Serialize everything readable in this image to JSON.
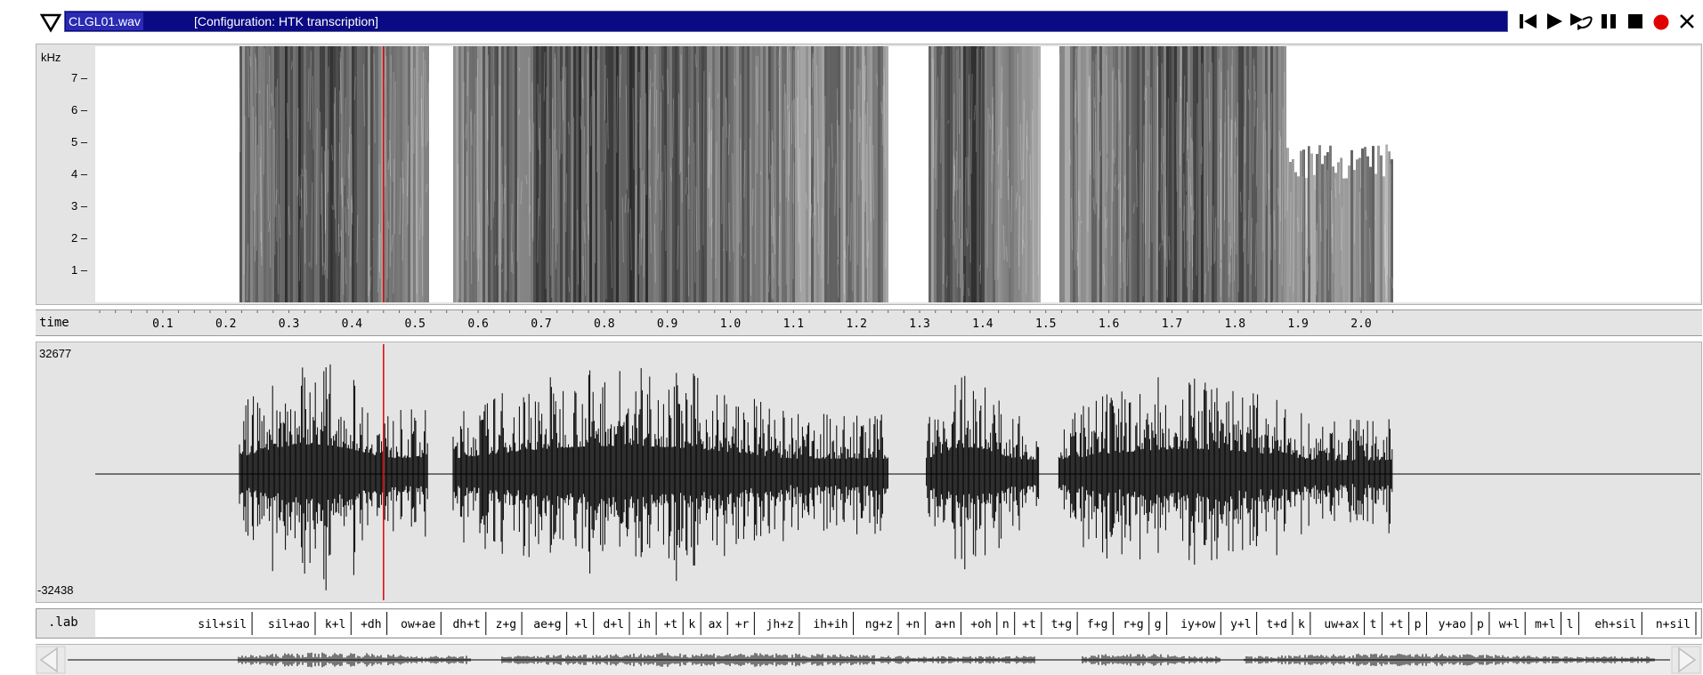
{
  "window": {
    "file_name": "CLGL01.wav",
    "configuration": "[Configuration: HTK transcription]",
    "accent_color": "#0a0a84",
    "record_color": "#e00000"
  },
  "toolbar": {
    "collapse_icon": "triangle-down-icon",
    "buttons": [
      {
        "name": "skip-to-start-button",
        "icon": "skip-start-icon"
      },
      {
        "name": "play-button",
        "icon": "play-icon"
      },
      {
        "name": "loop-play-button",
        "icon": "loop-play-icon"
      },
      {
        "name": "pause-button",
        "icon": "pause-icon"
      },
      {
        "name": "stop-button",
        "icon": "stop-icon"
      },
      {
        "name": "record-button",
        "icon": "record-dot-icon"
      },
      {
        "name": "close-button",
        "icon": "close-icon"
      }
    ]
  },
  "spectrogram": {
    "unit": "kHz",
    "ticks": [
      "7",
      "6",
      "5",
      "4",
      "3",
      "2",
      "1"
    ],
    "freq_max_khz": 8
  },
  "time_axis": {
    "label": "time",
    "ticks": [
      "0.1",
      "0.2",
      "0.3",
      "0.4",
      "0.5",
      "0.6",
      "0.7",
      "0.8",
      "0.9",
      "1.0",
      "1.1",
      "1.2",
      "1.3",
      "1.4",
      "1.5",
      "1.6",
      "1.7",
      "1.8",
      "1.9",
      "2.0"
    ],
    "range_s": [
      0.0,
      2.07
    ],
    "cursor_s": 0.45
  },
  "waveform": {
    "max_label": "32677",
    "min_label": "-32438"
  },
  "labels": {
    "tier_name": ".lab",
    "segments": [
      "sil+sil",
      "sil+ao",
      "k+l",
      "+dh",
      "ow+ae",
      "dh+t",
      "z+g",
      "ae+g",
      "+l",
      "d+l",
      "ih",
      "+t",
      "k",
      "ax",
      "+r",
      "jh+z",
      "ih+ih",
      "ng+z",
      "+n",
      "a+n",
      "+oh",
      "n",
      "+t",
      "t+g",
      "f+g",
      "r+g",
      "g",
      "iy+ow",
      "y+l",
      "t+d",
      "k",
      "uw+ax",
      "t",
      "+t",
      "p",
      "y+ao",
      "p",
      "w+l",
      "m+l",
      "l",
      "eh+sil",
      "n+sil"
    ]
  },
  "overview": {
    "left_arrow_icon": "scroll-left-icon",
    "right_arrow_icon": "scroll-right-icon"
  }
}
